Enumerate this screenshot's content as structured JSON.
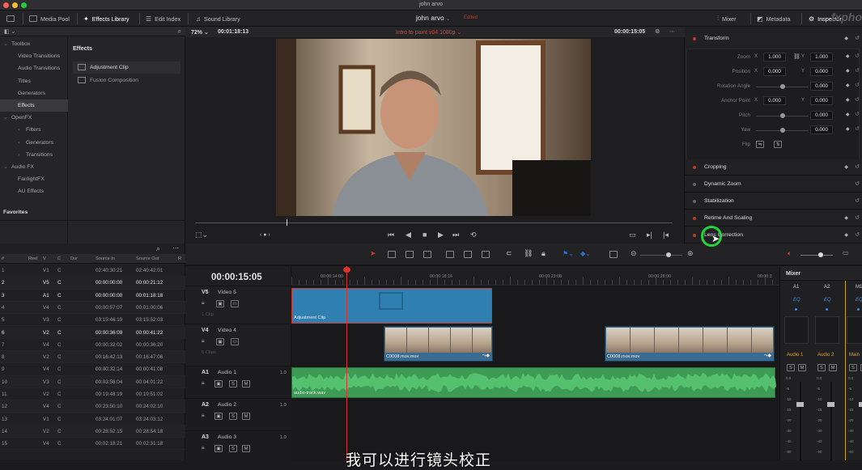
{
  "window_title": "john arvo",
  "toolbar": {
    "media_pool": "Media Pool",
    "effects_library": "Effects Library",
    "edit_index": "Edit Index",
    "sound_library": "Sound Library",
    "project_name": "john arvo",
    "edited": "Edited",
    "mixer": "Mixer",
    "metadata": "Metadata",
    "inspector": "Inspector",
    "watermark": "fxpho"
  },
  "library": {
    "tree": [
      {
        "label": "Toolbox",
        "level": 0,
        "arrow": "⌄"
      },
      {
        "label": "Video Transitions",
        "level": 1
      },
      {
        "label": "Audio Transitions",
        "level": 1
      },
      {
        "label": "Titles",
        "level": 1
      },
      {
        "label": "Generators",
        "level": 1
      },
      {
        "label": "Effects",
        "level": 1,
        "selected": true
      },
      {
        "label": "OpenFX",
        "level": 0,
        "arrow": "⌄"
      },
      {
        "label": "Filters",
        "level": 1,
        "arrow": "›"
      },
      {
        "label": "Generators",
        "level": 1,
        "arrow": "›"
      },
      {
        "label": "Transitions",
        "level": 1,
        "arrow": "›"
      },
      {
        "label": "Audio FX",
        "level": 0,
        "arrow": "⌄"
      },
      {
        "label": "FairlightFX",
        "level": 1
      },
      {
        "label": "AU Effects",
        "level": 1
      }
    ],
    "favorites": "Favorites",
    "effects_title": "Effects",
    "effects": [
      "Adjustment Clip",
      "Fusion Composition"
    ]
  },
  "viewer": {
    "zoom": "72%",
    "timecode_left": "00:01:18:13",
    "timeline_name": "Intro to paint v04 1080p",
    "timecode_right": "00:00:15:05"
  },
  "inspector": {
    "transform_title": "Transform",
    "params": [
      {
        "label": "Zoom",
        "ax1": "X",
        "v1": "1.000",
        "ax2": "Y",
        "v2": "1.000"
      },
      {
        "label": "Position",
        "ax1": "X",
        "v1": "0.000",
        "ax2": "Y",
        "v2": "0.000"
      },
      {
        "label": "Rotation Angle",
        "v2": "0.000",
        "slider": 0.5
      },
      {
        "label": "Anchor Point",
        "ax1": "X",
        "v1": "0.000",
        "ax2": "Y",
        "v2": "0.000"
      },
      {
        "label": "Pitch",
        "v2": "0.000",
        "slider": 0.5
      },
      {
        "label": "Yaw",
        "v2": "0.000",
        "slider": 0.5
      },
      {
        "label": "Flip"
      }
    ],
    "sections": [
      {
        "name": "Cropping",
        "dot": "red"
      },
      {
        "name": "Dynamic Zoom",
        "dot": "gray"
      },
      {
        "name": "Stabilization",
        "dot": "gray"
      },
      {
        "name": "Retime And Scaling",
        "dot": "red"
      },
      {
        "name": "Lens Correction",
        "dot": "red"
      }
    ]
  },
  "clip_list": {
    "headers": [
      "#",
      "Reel",
      "V",
      "C",
      "Dur",
      "Source In",
      "Source Out",
      "R"
    ],
    "rows": [
      [
        "1",
        "",
        "V1",
        "C",
        "",
        "02:40:30:21",
        "02:40:42:01",
        false
      ],
      [
        "2",
        "",
        "V5",
        "C",
        "",
        "00:00:00:00",
        "00:00:21:12",
        true
      ],
      [
        "3",
        "",
        "A1",
        "C",
        "",
        "00:00:00:00",
        "00:01:18:18",
        true
      ],
      [
        "4",
        "",
        "V4",
        "C",
        "",
        "00:00:57:07",
        "00:01:00:06",
        false
      ],
      [
        "5",
        "",
        "V3",
        "C",
        "",
        "03:15:46:19",
        "03:15:52:03",
        false
      ],
      [
        "6",
        "",
        "V2",
        "C",
        "",
        "00:00:36:09",
        "00:00:41:22",
        true
      ],
      [
        "7",
        "",
        "V4",
        "C",
        "",
        "00:00:32:02",
        "00:00:36:20",
        false
      ],
      [
        "8",
        "",
        "V2",
        "C",
        "",
        "00:16:42:13",
        "00:16:47:06",
        false
      ],
      [
        "9",
        "",
        "V4",
        "C",
        "",
        "00:00:32:14",
        "00:00:41:08",
        false
      ],
      [
        "10",
        "",
        "V3",
        "C",
        "",
        "00:03:58:04",
        "00:04:01:22",
        false
      ],
      [
        "11",
        "",
        "V2",
        "C",
        "",
        "00:19:48:19",
        "00:19:51:02",
        false
      ],
      [
        "12",
        "",
        "V4",
        "C",
        "",
        "00:23:50:10",
        "00:24:02:10",
        false
      ],
      [
        "13",
        "",
        "V1",
        "C",
        "",
        "03:24:01:07",
        "03:24:03:12",
        false
      ],
      [
        "14",
        "",
        "V2",
        "C",
        "",
        "00:28:52:15",
        "00:28:54:18",
        false
      ],
      [
        "15",
        "",
        "V4",
        "C",
        "",
        "00:02:18:21",
        "00:02:31:18",
        false
      ]
    ]
  },
  "timeline": {
    "timecode": "00:00:15:05",
    "ruler": [
      "00:00:14:00",
      "00:00:18:16",
      "00:00:23:08",
      "00:00:28:00",
      "00:00:3"
    ],
    "tracks": [
      {
        "id": "V5",
        "name": "Video 5",
        "count": "1 Clip"
      },
      {
        "id": "V4",
        "name": "Video 4",
        "count": "5 Clips"
      },
      {
        "id": "A1",
        "name": "Audio 1",
        "chan": "1.0"
      },
      {
        "id": "A2",
        "name": "Audio 2",
        "chan": "1.0"
      },
      {
        "id": "A3",
        "name": "Audio 3",
        "chan": "1.0"
      }
    ],
    "clips": {
      "adjustment": "Adjustment Clip",
      "video_a": "C0008.mov.mov",
      "video_b": "C0008.mov.mov",
      "audio": "audio-track.wav"
    }
  },
  "mixer": {
    "title": "Mixer",
    "channels": [
      "A1",
      "A2",
      "M1"
    ],
    "eq": "EQ",
    "names": [
      "Audio 1",
      "Audio 2",
      "Main"
    ],
    "scale": [
      "0.0",
      "-5",
      "-10",
      "-15",
      "-20",
      "-30",
      "-40",
      "-50"
    ],
    "s": "S",
    "m": "M"
  },
  "subtitle": "我可以进行镜头校正",
  "colors": {
    "accent_red": "#c0392b",
    "cursor_ring": "#23d53d",
    "video_clip": "#2e78a8",
    "audio_clip": "#3d9b55"
  }
}
